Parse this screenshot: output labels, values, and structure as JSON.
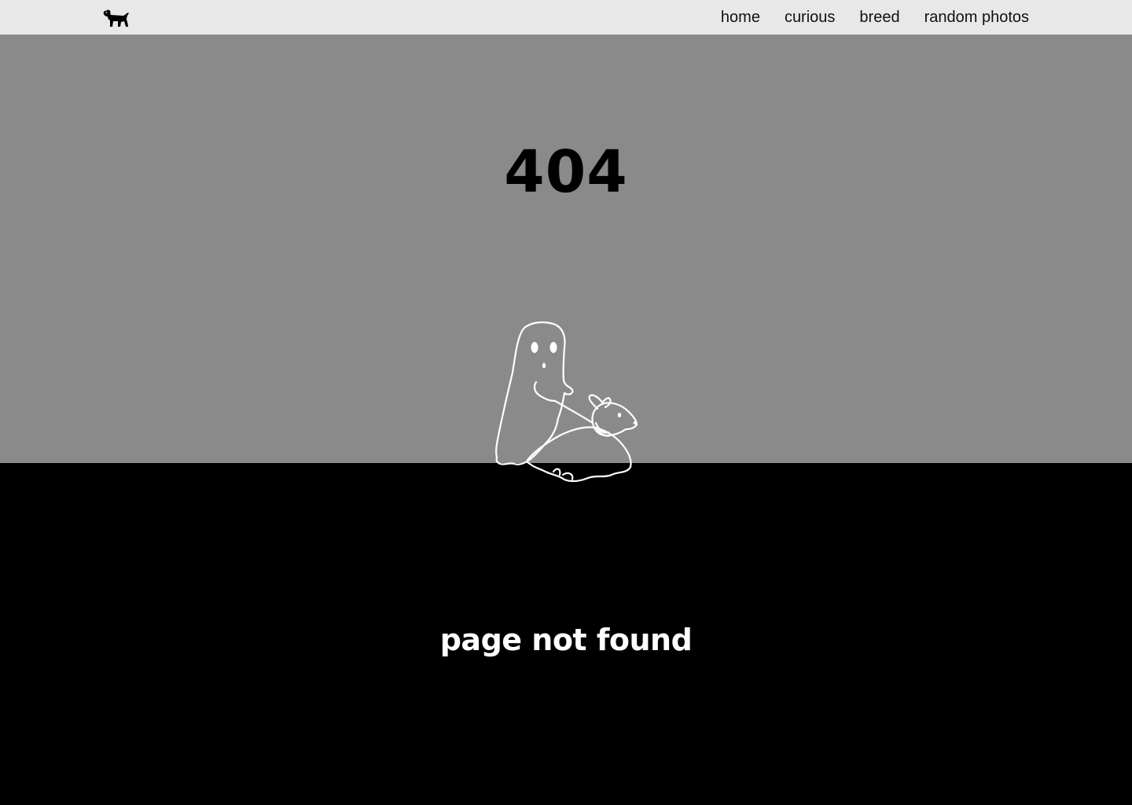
{
  "nav": {
    "logo_icon": "dog-silhouette-icon",
    "links": [
      {
        "label": "home"
      },
      {
        "label": "curious"
      },
      {
        "label": "breed"
      },
      {
        "label": "random photos"
      }
    ]
  },
  "main": {
    "error_code": "404",
    "illustration_icon": "ghost-walking-dog-illustration",
    "message": "page not found"
  },
  "colors": {
    "navbar_bg": "#e8e8e8",
    "hero_bg": "#8a8a8a",
    "bottom_bg": "#000000",
    "heading_dark": "#000000",
    "heading_light": "#ffffff"
  }
}
